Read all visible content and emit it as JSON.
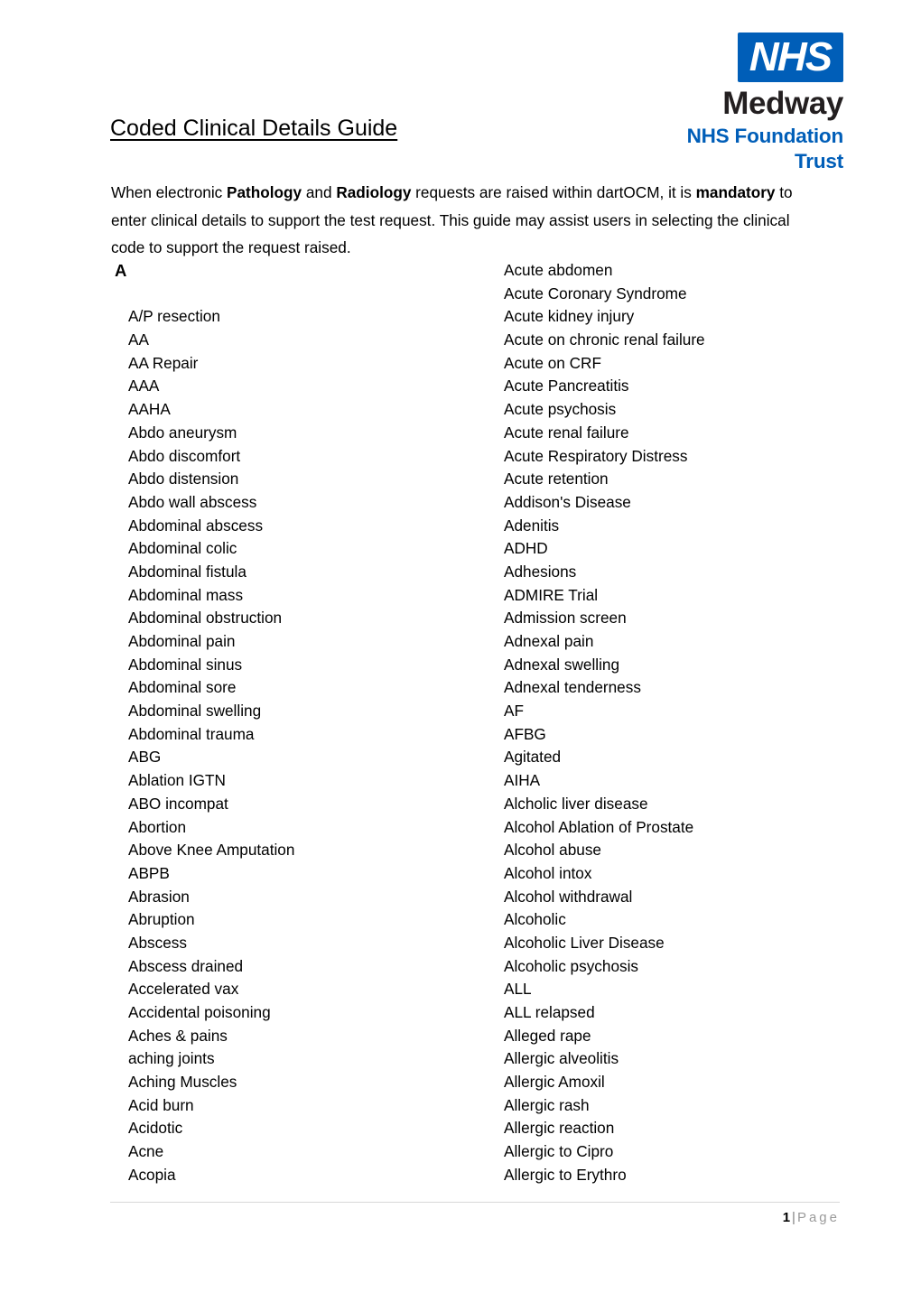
{
  "document": {
    "title": "Coded Clinical Details Guide",
    "intro": {
      "part1": "When electronic ",
      "bold1": "Pathology",
      "part2": " and ",
      "bold2": "Radiology",
      "part3": " requests are raised within dartOCM, it is ",
      "bold3": "mandatory",
      "part4": " to enter clinical details to support the test request.  This guide may assist users in selecting the clinical code to support the request raised."
    }
  },
  "logo": {
    "badge_text": "NHS",
    "trust_name": "Medway",
    "trust_subtitle": "NHS Foundation Trust",
    "brand_blue": "#005EB8"
  },
  "section": {
    "letter": "A"
  },
  "columns": {
    "left": [
      "A/P resection",
      "AA",
      "AA Repair",
      "AAA",
      "AAHA",
      "Abdo aneurysm",
      "Abdo discomfort",
      "Abdo distension",
      "Abdo wall abscess",
      "Abdominal abscess",
      "Abdominal colic",
      "Abdominal fistula",
      "Abdominal mass",
      "Abdominal obstruction",
      "Abdominal pain",
      "Abdominal sinus",
      "Abdominal sore",
      "Abdominal swelling",
      "Abdominal trauma",
      "ABG",
      "Ablation IGTN",
      "ABO incompat",
      "Abortion",
      "Above Knee Amputation",
      "ABPB",
      "Abrasion",
      "Abruption",
      "Abscess",
      "Abscess drained",
      "Accelerated vax",
      "Accidental poisoning",
      "Aches & pains",
      "aching joints",
      "Aching Muscles",
      "Acid burn",
      "Acidotic",
      "Acne",
      "Acopia"
    ],
    "right": [
      "Acute abdomen",
      "Acute Coronary Syndrome",
      "Acute kidney injury",
      "Acute on chronic renal failure",
      "Acute on CRF",
      "Acute Pancreatitis",
      "Acute psychosis",
      "Acute renal failure",
      "Acute Respiratory Distress",
      "Acute retention",
      "Addison's Disease",
      "Adenitis",
      "ADHD",
      "Adhesions",
      "ADMIRE Trial",
      "Admission screen",
      "Adnexal pain",
      "Adnexal swelling",
      "Adnexal tenderness",
      "AF",
      "AFBG",
      "Agitated",
      "AIHA",
      "Alcholic liver disease",
      "Alcohol Ablation of Prostate",
      "Alcohol abuse",
      "Alcohol intox",
      "Alcohol withdrawal",
      "Alcoholic",
      "Alcoholic Liver Disease",
      "Alcoholic psychosis",
      "ALL",
      "ALL relapsed",
      "Alleged rape",
      "Allergic alveolitis",
      "Allergic Amoxil",
      "Allergic rash",
      "Allergic reaction",
      "Allergic to Cipro",
      "Allergic to Erythro"
    ]
  },
  "footer": {
    "page_number": "1",
    "separator": "|",
    "page_word": "Page"
  }
}
